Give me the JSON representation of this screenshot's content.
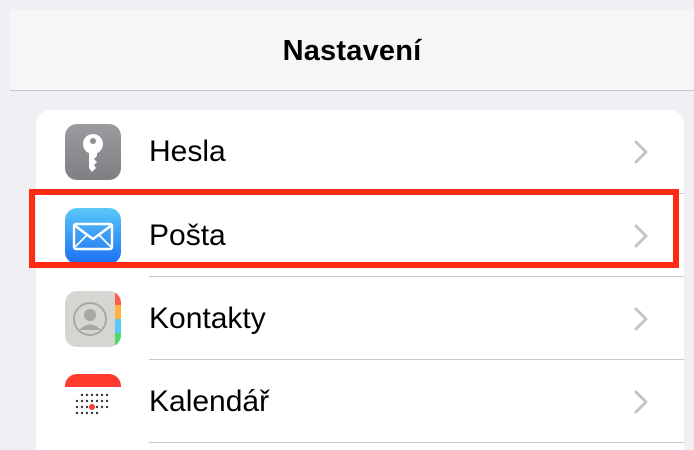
{
  "nav": {
    "title": "Nastavení"
  },
  "settings": {
    "items": [
      {
        "label": "Hesla",
        "icon": "key-icon",
        "chevron": "chevron-right-icon"
      },
      {
        "label": "Pošta",
        "icon": "mail-icon",
        "chevron": "chevron-right-icon"
      },
      {
        "label": "Kontakty",
        "icon": "contacts-icon",
        "chevron": "chevron-right-icon"
      },
      {
        "label": "Kalendář",
        "icon": "calendar-icon",
        "chevron": "chevron-right-icon"
      }
    ]
  },
  "highlight": {
    "target": "Pošta",
    "color": "#ff2a12"
  },
  "colors": {
    "background": "#efeff4",
    "nav_background": "#f6f6f6",
    "separator": "#c8c7cc",
    "chevron": "#c4c4c7",
    "mail_gradient_top": "#5ac8fa",
    "mail_gradient_bottom": "#1d6ff2",
    "key_icon_gray": "#8e8e93",
    "calendar_red": "#ff3b30"
  }
}
